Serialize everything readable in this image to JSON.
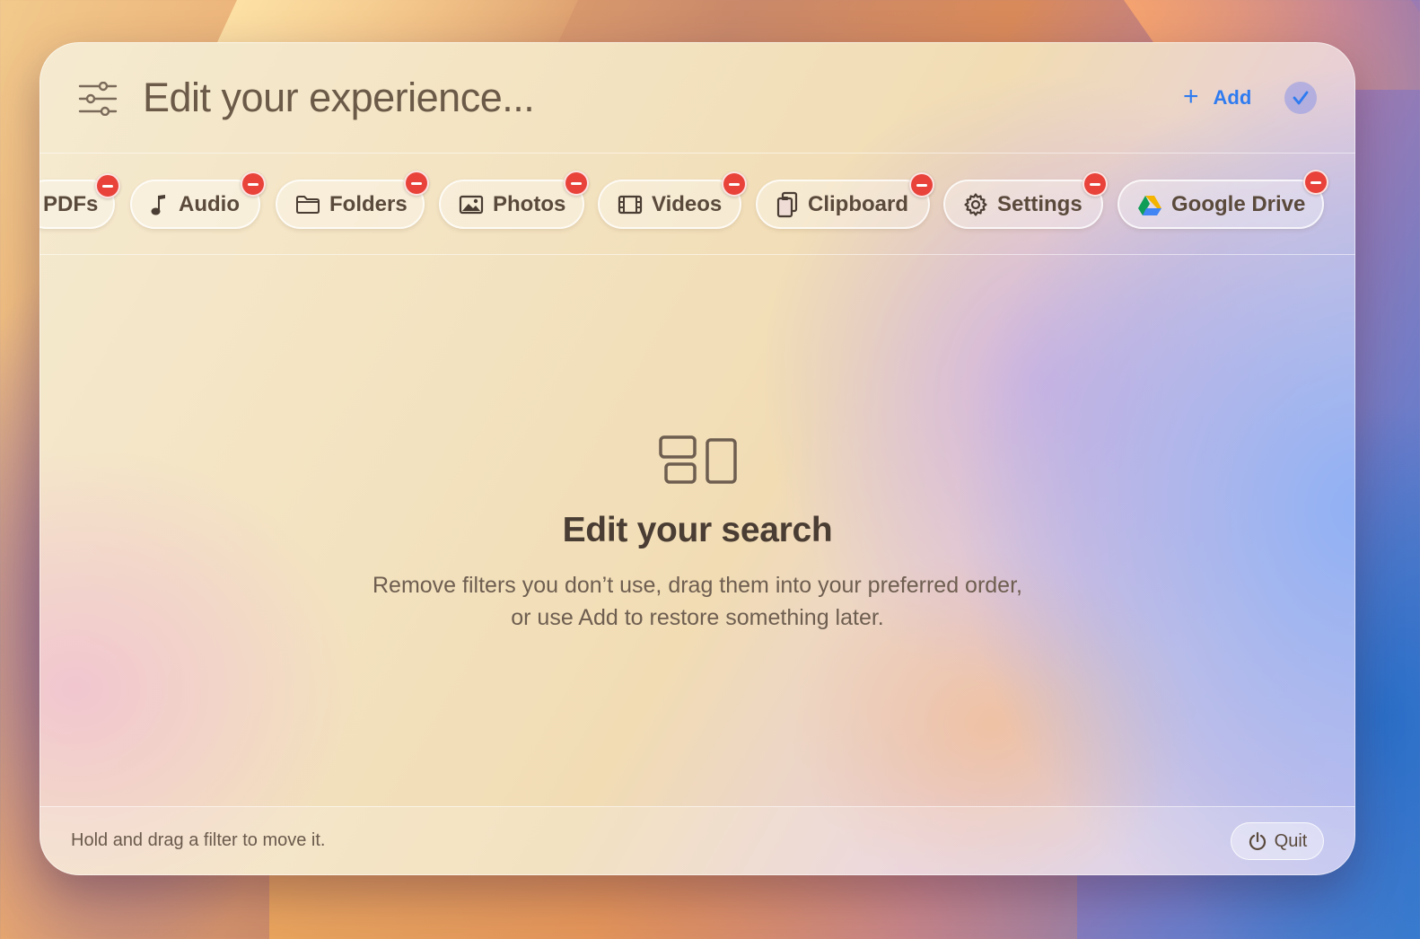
{
  "header": {
    "title": "Edit your experience...",
    "add_label": "Add"
  },
  "filters": [
    {
      "label": "PDFs",
      "icon": "pdf-icon"
    },
    {
      "label": "Audio",
      "icon": "music-note-icon"
    },
    {
      "label": "Folders",
      "icon": "folder-icon"
    },
    {
      "label": "Photos",
      "icon": "photo-icon"
    },
    {
      "label": "Videos",
      "icon": "film-icon"
    },
    {
      "label": "Clipboard",
      "icon": "clipboard-icon"
    },
    {
      "label": "Settings",
      "icon": "gear-icon"
    },
    {
      "label": "Google Drive",
      "icon": "google-drive-icon"
    }
  ],
  "empty_state": {
    "title": "Edit your search",
    "description_line1": "Remove filters you don’t use, drag them into your preferred order,",
    "description_line2": "or use Add to restore something later."
  },
  "footer": {
    "hint": "Hold and drag a filter to move it.",
    "quit_label": "Quit"
  },
  "colors": {
    "accent": "#2f7bf0",
    "remove_badge": "#e8423a",
    "text_primary": "#4a3d33"
  }
}
